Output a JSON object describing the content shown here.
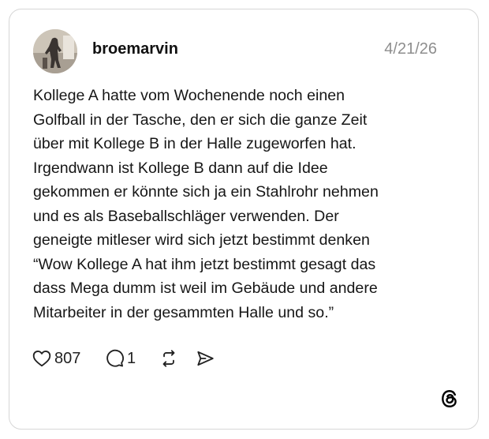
{
  "post": {
    "username": "broemarvin",
    "date": "4/21/26",
    "text_lines": [
      "Kollege A hatte vom Wochenende noch einen",
      "Golfball in der Tasche, den er sich die ganze Zeit",
      "über mit Kollege B in der Halle zugeworfen hat.",
      "Irgendwann ist Kollege B dann auf die Idee",
      "gekommen er könnte sich ja ein Stahlrohr nehmen",
      "und es als Baseballschläger verwenden. Der",
      "geneigte mitleser wird sich jetzt bestimmt denken",
      "“Wow Kollege A hat ihm jetzt bestimmt gesagt das",
      "dass Mega dumm ist weil im Gebäude und andere",
      "Mitarbeiter in der gesammten Halle und so.”"
    ]
  },
  "actions": {
    "likes": "807",
    "replies": "1"
  },
  "icons": {
    "like": "heart-icon",
    "reply": "speech-bubble-icon",
    "repost": "repost-icon",
    "share": "send-icon",
    "logo": "threads-logo-icon"
  },
  "colors": {
    "date": "#8e8e8e",
    "border": "#d6d6d6"
  }
}
